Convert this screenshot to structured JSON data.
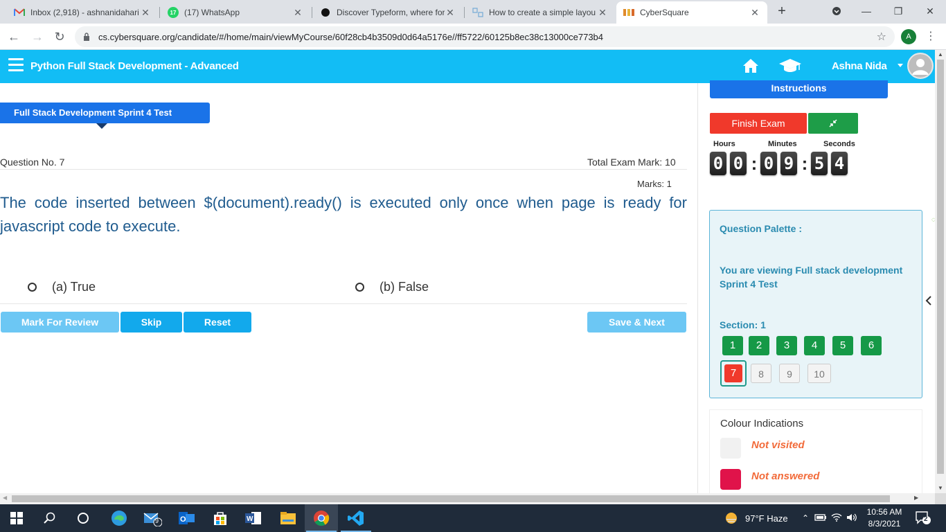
{
  "browser": {
    "tabs": [
      {
        "label": "Inbox (2,918) - ashnanidahari",
        "icon": "gmail-icon"
      },
      {
        "label": "(17) WhatsApp",
        "icon": "whatsapp-icon",
        "badge": "17"
      },
      {
        "label": "Discover Typeform, where for",
        "icon": "typeform-icon"
      },
      {
        "label": "How to create a simple layou",
        "icon": "layout-site-icon"
      },
      {
        "label": "CyberSquare",
        "icon": "cybersquare-icon"
      }
    ],
    "url": "cs.cybersquare.org/candidate/#/home/main/viewMyCourse/60f28cb4b3509d0d64a5176e//ff5722/60125b8ec38c13000ce773b4",
    "profile_initial": "A"
  },
  "header": {
    "title": "Python Full Stack Development - Advanced",
    "user_name": "Ashna Nida"
  },
  "exam": {
    "test_name": "Full Stack Development Sprint 4 Test",
    "question_no": "Question No. 7",
    "total_mark": "Total Exam Mark: 10",
    "marks": "Marks: 1",
    "question": "The code inserted between $(document).ready() is executed only once when page is ready for javascript code to execute.",
    "options": [
      "(a) True",
      "(b) False"
    ],
    "buttons": {
      "mark_review": "Mark For Review",
      "skip": "Skip",
      "reset": "Reset",
      "save_next": "Save & Next"
    }
  },
  "side": {
    "instructions": "Instructions",
    "finish": "Finish Exam",
    "timer_labels": {
      "hours": "Hours",
      "minutes": "Minutes",
      "seconds": "Seconds"
    },
    "timer_digits": [
      "0",
      "0",
      "0",
      "9",
      "5",
      "4"
    ],
    "palette_title": "Question Palette :",
    "palette_view": "You are viewing Full stack development Sprint 4 Test",
    "section": "Section: 1",
    "questions": [
      {
        "num": "1",
        "state": "answered"
      },
      {
        "num": "2",
        "state": "answered"
      },
      {
        "num": "3",
        "state": "answered"
      },
      {
        "num": "4",
        "state": "answered"
      },
      {
        "num": "5",
        "state": "answered"
      },
      {
        "num": "6",
        "state": "answered"
      },
      {
        "num": "7",
        "state": "current"
      },
      {
        "num": "8",
        "state": "not-visited"
      },
      {
        "num": "9",
        "state": "not-visited"
      },
      {
        "num": "10",
        "state": "not-visited"
      }
    ],
    "colour_title": "Colour Indications",
    "colour_items": [
      {
        "label": "Not visited",
        "color": "#f1f1f1"
      },
      {
        "label": "Not answered",
        "color": "#e0134a"
      }
    ]
  },
  "taskbar": {
    "weather": "97°F  Haze",
    "time": "10:56 AM",
    "date": "8/3/2021",
    "mail_badge": "9",
    "notif_count": "2"
  },
  "colors": {
    "appbar": "#12bdf5",
    "primary": "#1a73e8",
    "answered": "#159947",
    "current": "#f0392b"
  }
}
